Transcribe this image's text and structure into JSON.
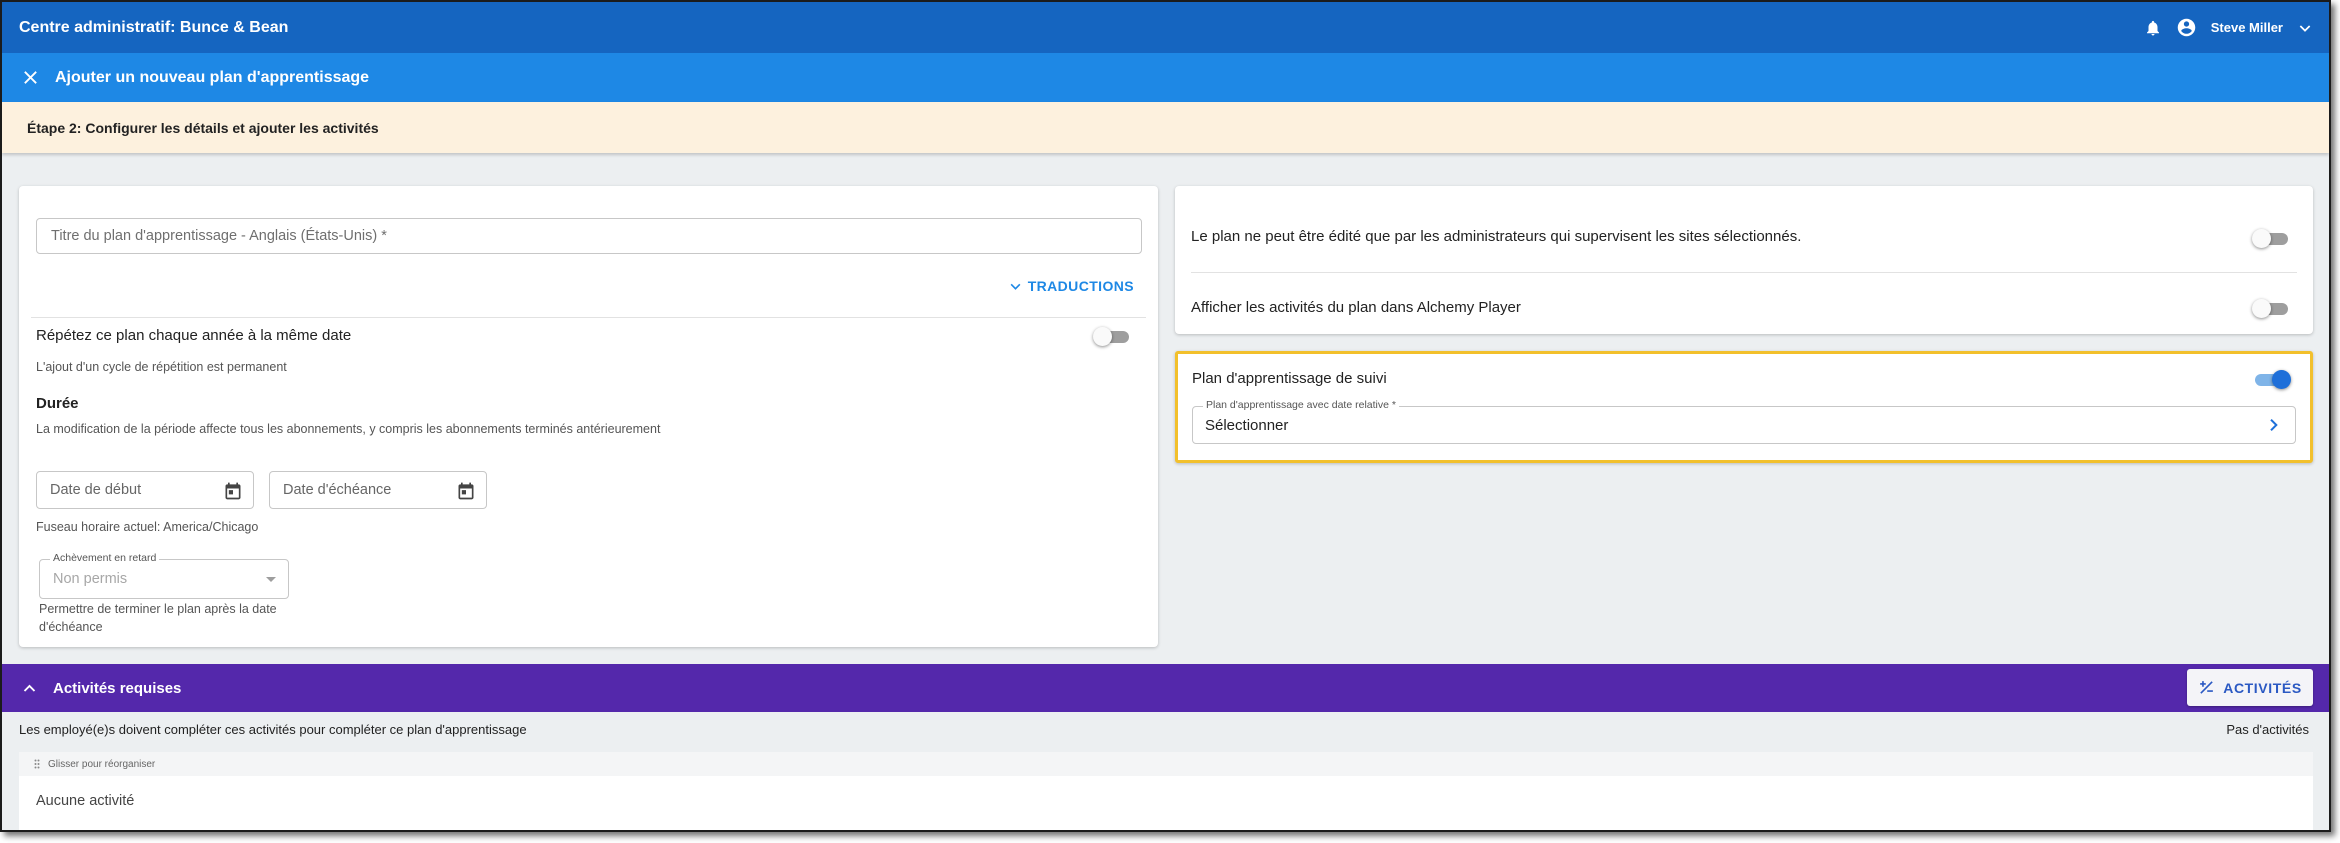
{
  "app": {
    "title": "Centre administratif: Bunce & Bean",
    "user_name": "Steve Miller"
  },
  "header": {
    "subtitle": "Ajouter un nouveau plan d'apprentissage"
  },
  "step": {
    "text": "Étape 2: Configurer les détails et ajouter les activités"
  },
  "left_panel": {
    "title_placeholder": "Titre du plan d'apprentissage - Anglais (États-Unis) *",
    "translations_label": "TRADUCTIONS",
    "repeat_label": "Répétez ce plan chaque année à la même date",
    "repeat_toggle_on": false,
    "repeat_hint": "L'ajout d'un cycle de répétition est permanent",
    "duration_heading": "Durée",
    "duration_hint": "La modification de la période affecte tous les abonnements, y compris les abonnements terminés antérieurement",
    "start_date_placeholder": "Date de début",
    "due_date_placeholder": "Date d'échéance",
    "timezone_text": "Fuseau horaire actuel: America/Chicago",
    "late_completion": {
      "label": "Achèvement en retard",
      "value": "Non permis",
      "hint_line1": "Permettre de terminer le plan après la date",
      "hint_line2": "d'échéance"
    }
  },
  "right_panel": {
    "admin_only_label": "Le plan ne peut être édité que par les administrateurs qui supervisent les sites sélectionnés.",
    "admin_only_on": false,
    "show_in_player_label": "Afficher les activités du plan dans Alchemy Player",
    "show_in_player_on": false,
    "followup": {
      "label": "Plan d'apprentissage de suivi",
      "on": true,
      "relative_label": "Plan d'apprentissage avec date relative *",
      "relative_value": "Sélectionner"
    }
  },
  "activities": {
    "section_title": "Activités requises",
    "button_label": "ACTIVITÉS",
    "description": "Les employé(e)s doivent compléter ces activités pour compléter ce plan d'apprentissage",
    "status": "Pas d'activités",
    "drag_hint": "Glisser pour réorganiser",
    "empty_text": "Aucune activité"
  },
  "colors": {
    "topbar": "#1565c0",
    "subbar": "#1e88e5",
    "section_purple": "#5428ab",
    "highlight": "#f2c02c",
    "step_banner": "#fdf1de"
  }
}
